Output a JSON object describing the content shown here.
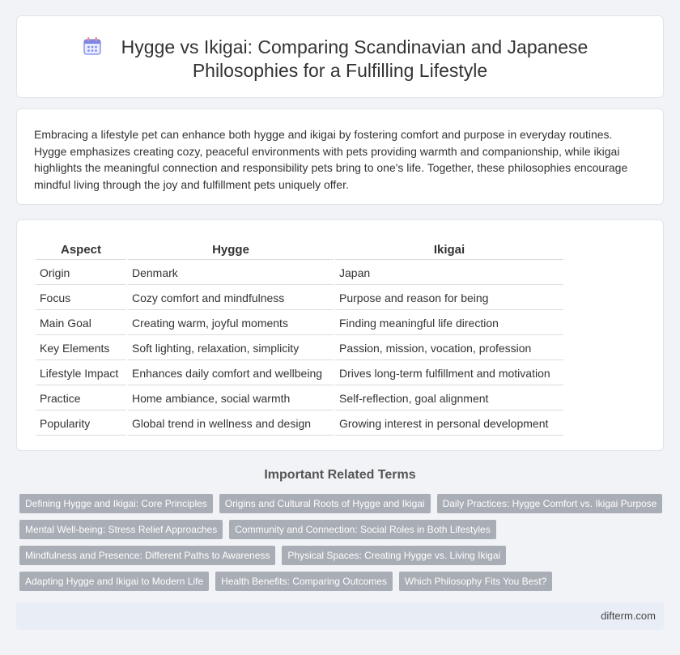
{
  "header": {
    "title": "Hygge vs Ikigai: Comparing Scandinavian and Japanese Philosophies for a Fulfilling Lifestyle",
    "icon": "calendar-icon"
  },
  "intro": {
    "text": "Embracing a lifestyle pet can enhance both hygge and ikigai by fostering comfort and purpose in everyday routines. Hygge emphasizes creating cozy, peaceful environments with pets providing warmth and companionship, while ikigai highlights the meaningful connection and responsibility pets bring to one's life. Together, these philosophies encourage mindful living through the joy and fulfillment pets uniquely offer."
  },
  "table": {
    "headers": [
      "Aspect",
      "Hygge",
      "Ikigai"
    ],
    "rows": [
      [
        "Origin",
        "Denmark",
        "Japan"
      ],
      [
        "Focus",
        "Cozy comfort and mindfulness",
        "Purpose and reason for being"
      ],
      [
        "Main Goal",
        "Creating warm, joyful moments",
        "Finding meaningful life direction"
      ],
      [
        "Key Elements",
        "Soft lighting, relaxation, simplicity",
        "Passion, mission, vocation, profession"
      ],
      [
        "Lifestyle Impact",
        "Enhances daily comfort and wellbeing",
        "Drives long-term fulfillment and motivation"
      ],
      [
        "Practice",
        "Home ambiance, social warmth",
        "Self-reflection, goal alignment"
      ],
      [
        "Popularity",
        "Global trend in wellness and design",
        "Growing interest in personal development"
      ]
    ]
  },
  "related": {
    "heading": "Important Related Terms",
    "tags": [
      [
        "Defining Hygge and Ikigai: Core Principles",
        "Origins and Cultural Roots of Hygge and Ikigai",
        "Daily Practices: Hygge Comfort vs. Ikigai Purpose"
      ],
      [
        "Mental Well-being: Stress Relief Approaches",
        "Community and Connection: Social Roles in Both Lifestyles"
      ],
      [
        "Mindfulness and Presence: Different Paths to Awareness",
        "Physical Spaces: Creating Hygge vs. Living Ikigai"
      ],
      [
        "Adapting Hygge and Ikigai to Modern Life",
        "Health Benefits: Comparing Outcomes",
        "Which Philosophy Fits You Best?"
      ]
    ]
  },
  "footer": {
    "text": "difterm.com"
  }
}
